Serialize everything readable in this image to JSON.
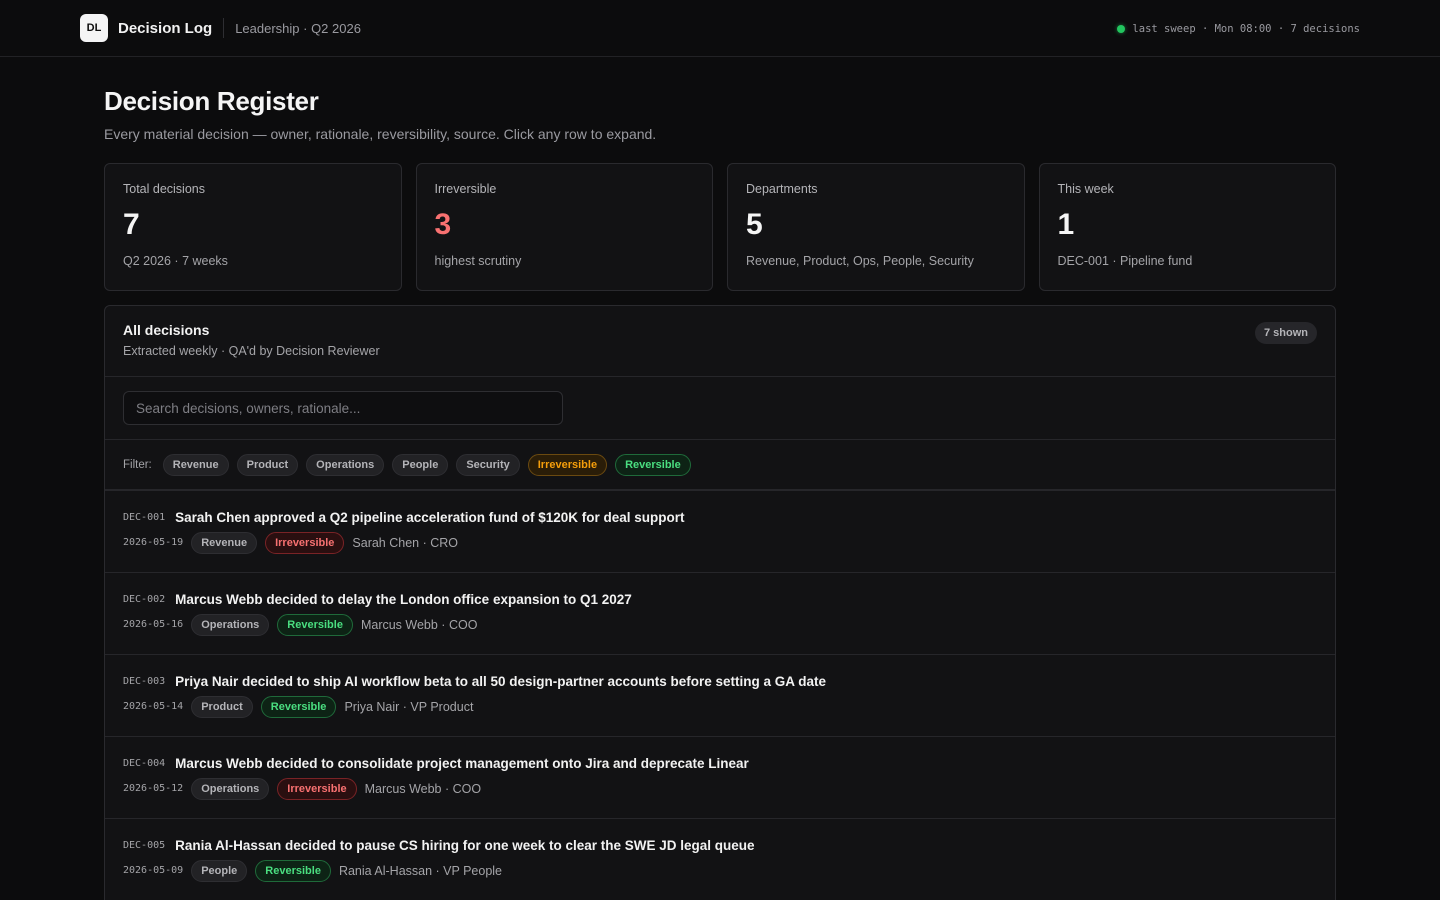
{
  "header": {
    "logo_text": "DL",
    "app_title": "Decision Log",
    "breadcrumb": "Leadership · Q2 2026",
    "status_text": "last sweep · Mon 08:00 · 7 decisions"
  },
  "page": {
    "title": "Decision Register",
    "subtitle": "Every material decision — owner, rationale, reversibility, source. Click any row to expand."
  },
  "stats": [
    {
      "label": "Total decisions",
      "value": "7",
      "sub": "Q2 2026 · 7 weeks"
    },
    {
      "label": "Irreversible",
      "value": "3",
      "sub": "highest scrutiny"
    },
    {
      "label": "Departments",
      "value": "5",
      "sub": "Revenue, Product, Ops, People, Security"
    },
    {
      "label": "This week",
      "value": "1",
      "sub": "DEC-001 · Pipeline fund"
    }
  ],
  "panel": {
    "title": "All decisions",
    "subtitle": "Extracted weekly · QA'd by Decision Reviewer",
    "count_badge": "7 shown",
    "search_placeholder": "Search decisions, owners, rationale...",
    "filter_label": "Filter:",
    "filters": [
      "Revenue",
      "Product",
      "Operations",
      "People",
      "Security",
      "Irreversible",
      "Reversible"
    ]
  },
  "decisions": [
    {
      "id": "DEC-001",
      "title": "Sarah Chen approved a Q2 pipeline acceleration fund of $120K for deal support",
      "date": "2026-05-19",
      "dept": "Revenue",
      "reversibility": "Irreversible",
      "owner": "Sarah Chen · CRO"
    },
    {
      "id": "DEC-002",
      "title": "Marcus Webb decided to delay the London office expansion to Q1 2027",
      "date": "2026-05-16",
      "dept": "Operations",
      "reversibility": "Reversible",
      "owner": "Marcus Webb · COO"
    },
    {
      "id": "DEC-003",
      "title": "Priya Nair decided to ship AI workflow beta to all 50 design-partner accounts before setting a GA date",
      "date": "2026-05-14",
      "dept": "Product",
      "reversibility": "Reversible",
      "owner": "Priya Nair · VP Product"
    },
    {
      "id": "DEC-004",
      "title": "Marcus Webb decided to consolidate project management onto Jira and deprecate Linear",
      "date": "2026-05-12",
      "dept": "Operations",
      "reversibility": "Irreversible",
      "owner": "Marcus Webb · COO"
    },
    {
      "id": "DEC-005",
      "title": "Rania Al-Hassan decided to pause CS hiring for one week to clear the SWE JD legal queue",
      "date": "2026-05-09",
      "dept": "People",
      "reversibility": "Reversible",
      "owner": "Rania Al-Hassan · VP People"
    }
  ],
  "colors": {
    "irreversible": "#f87171",
    "reversible": "#4ade80",
    "amber": "#f59e0b",
    "status_dot": "#22c55e"
  }
}
